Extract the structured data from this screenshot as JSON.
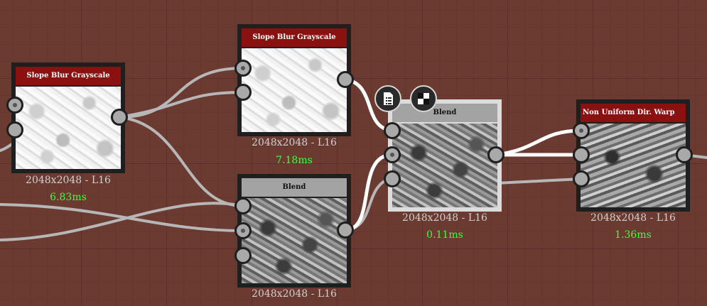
{
  "graph": {
    "nodes": [
      {
        "title": "Slope Blur Grayscale",
        "resolution": "2048x2048 - L16",
        "time": "6.83ms"
      },
      {
        "title": "Slope Blur Grayscale",
        "resolution": "2048x2048 - L16",
        "time": "7.18ms"
      },
      {
        "title": "Blend",
        "resolution": "2048x2048 - L16",
        "time": ""
      },
      {
        "title": "Blend",
        "resolution": "2048x2048 - L16",
        "time": "0.11ms"
      },
      {
        "title": "Non Uniform Dir. Warp",
        "resolution": "2048x2048 - L16",
        "time": "1.36ms"
      }
    ]
  },
  "icons": {
    "float_button_1": "document-list-icon",
    "float_button_2": "checker-pattern-icon"
  },
  "colors": {
    "canvas": "#6b3a30",
    "header_red": "#8b1010",
    "header_gray": "#a3a3a3",
    "time_green": "#3dff3d",
    "wire": "#b8b8b8",
    "wire_selected": "#ffffff"
  }
}
